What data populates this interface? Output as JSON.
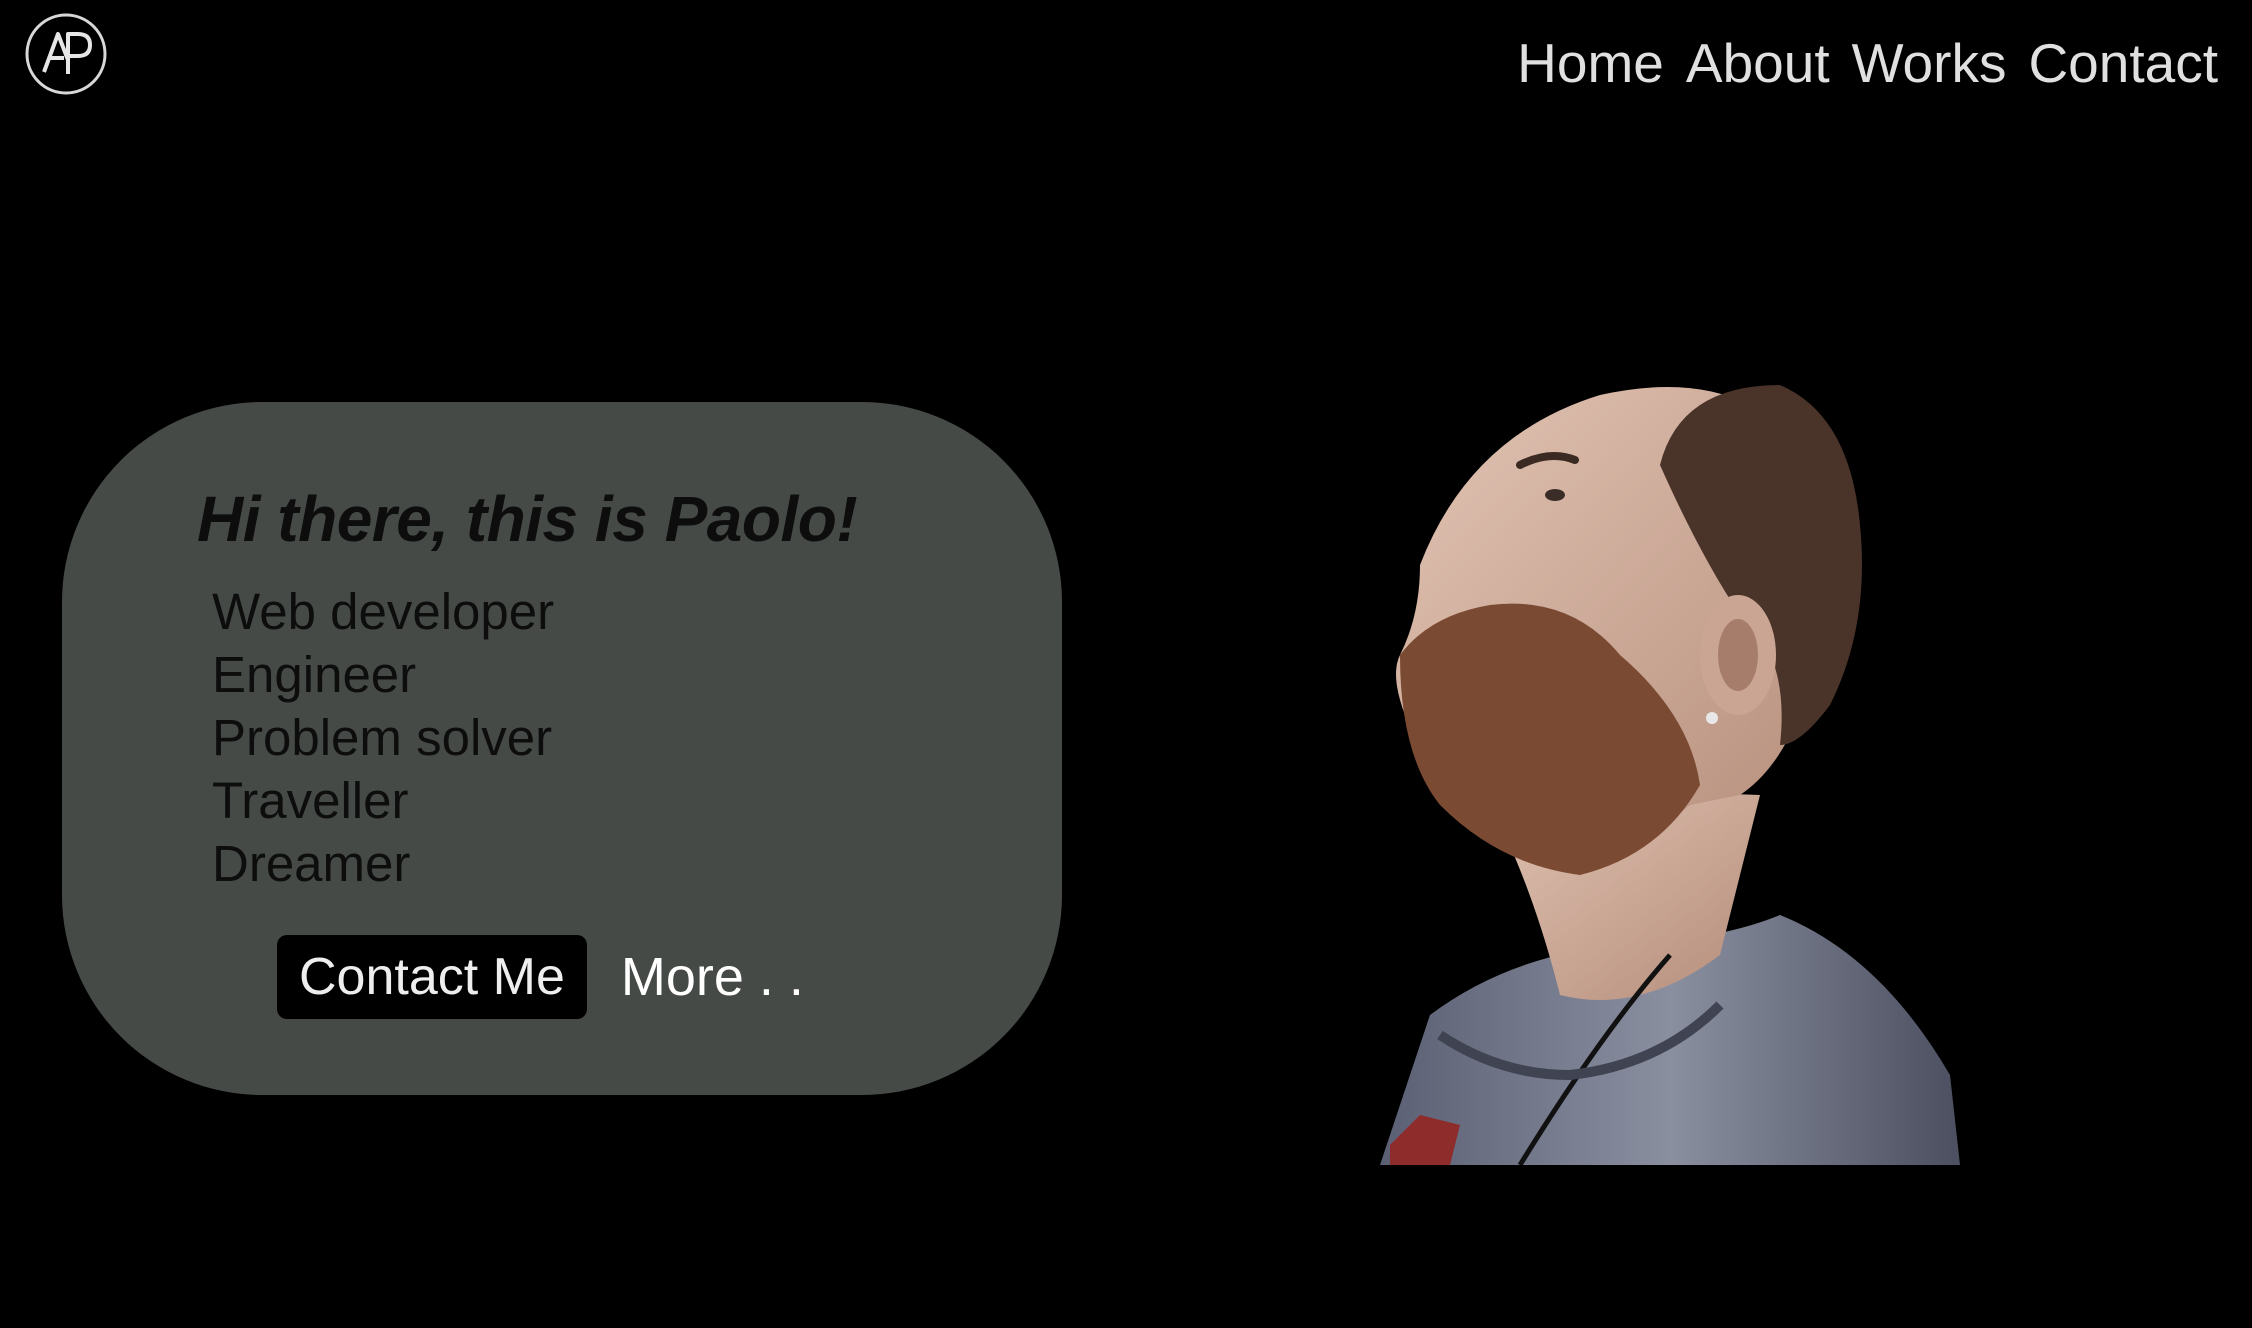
{
  "logo": {
    "text": "AP",
    "icon": "monogram-logo-icon"
  },
  "nav": {
    "items": [
      "Home",
      "About",
      "Works",
      "Contact"
    ]
  },
  "hero": {
    "title": "Hi there, this is Paolo!",
    "roles": [
      "Web developer",
      "Engineer",
      "Problem solver",
      "Traveller",
      "Dreamer"
    ],
    "contact_button": "Contact Me",
    "more_link": "More . ."
  },
  "portrait": {
    "description_icon": "portrait-photo"
  },
  "colors": {
    "background": "#000000",
    "card": "#464a47",
    "nav_text": "#e0e0e0",
    "card_text": "#0d0d0d"
  }
}
